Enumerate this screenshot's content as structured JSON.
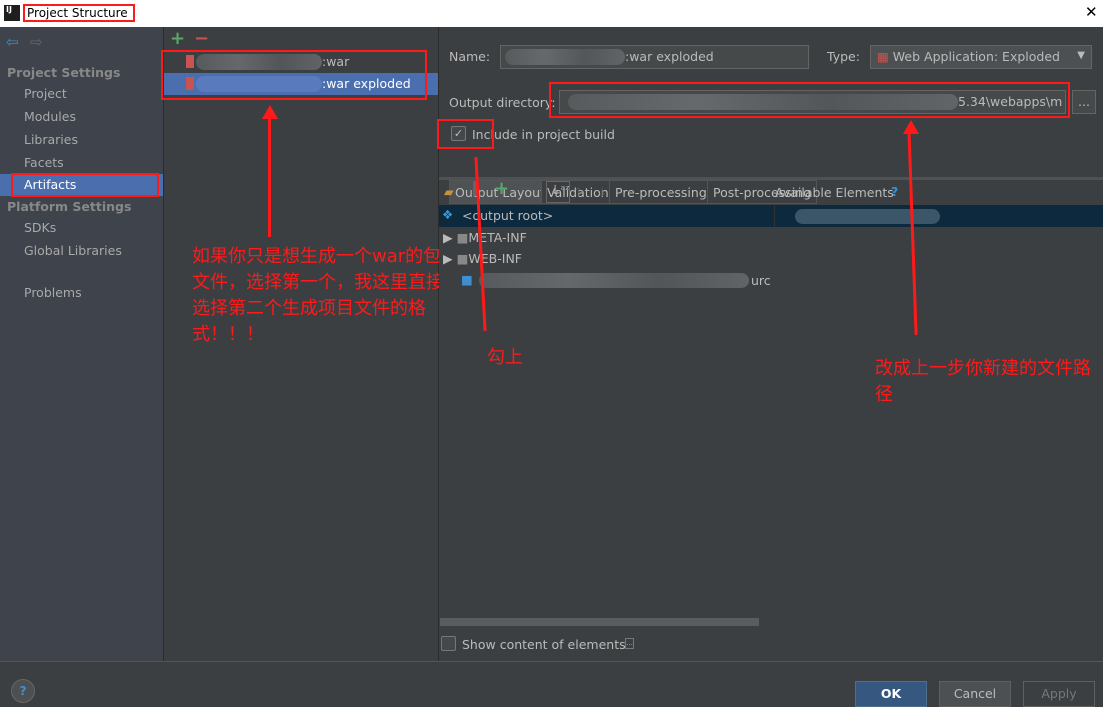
{
  "window": {
    "title": "Project Structure",
    "logo": "IJ"
  },
  "sidebar": {
    "section1": "Project Settings",
    "items1": [
      "Project",
      "Modules",
      "Libraries",
      "Facets",
      "Artifacts"
    ],
    "section2": "Platform Settings",
    "items2": [
      "SDKs",
      "Global Libraries"
    ],
    "problems": "Problems",
    "selected": "Artifacts"
  },
  "artifacts": {
    "items": [
      ":war",
      ":war exploded"
    ],
    "selected_index": 1
  },
  "form": {
    "name_label": "Name:",
    "name_value": ":war exploded",
    "type_label": "Type:",
    "type_value": "Web Application: Exploded",
    "outdir_label": "Output directory:",
    "outdir_value": "5.34\\webapps\\m",
    "browse": "...",
    "include_label": "Include in project build",
    "include_checked": true
  },
  "tabs": [
    "Output Layout",
    "Validation",
    "Pre-processing",
    "Post-processing"
  ],
  "layout": {
    "available": "Available Elements",
    "help": "?",
    "tree": [
      "<output root>",
      "META-INF",
      "WEB-INF",
      "urc"
    ],
    "show_content": "Show content of elements",
    "show_content_checked": false
  },
  "footer": {
    "ok": "OK",
    "cancel": "Cancel",
    "apply": "Apply",
    "help": "?"
  },
  "annotations": {
    "left": "如果你只是想生成一个war的包文件，选择第一个，我这里直接选择第二个生成项目文件的格式！！！",
    "check": "勾上",
    "right": "改成上一步你新建的文件路径"
  },
  "colors": {
    "selection": "#4b6eaf",
    "annotation": "#ff1a1a",
    "add": "#59a869",
    "remove": "#c75450"
  }
}
